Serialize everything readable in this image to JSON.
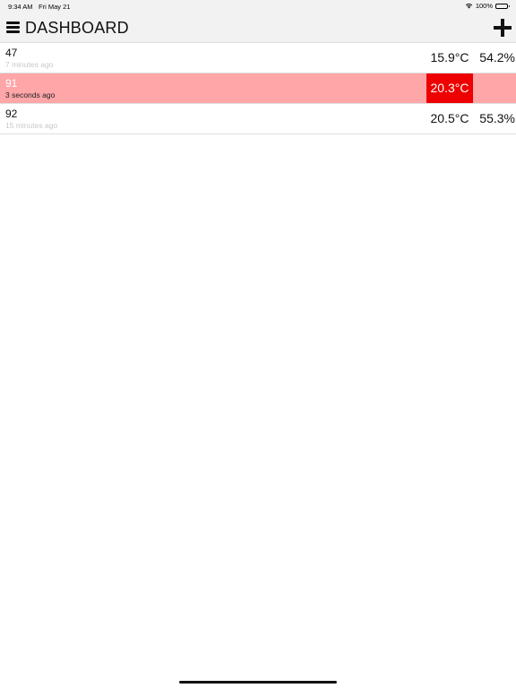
{
  "status_bar": {
    "time": "9:34 AM",
    "date": "Fri May 21",
    "battery": "100%",
    "icons": [
      "wifi-icon",
      "battery-icon"
    ]
  },
  "nav": {
    "title": "DASHBOARD",
    "menu_icon": "hamburger-menu-icon",
    "add_icon": "plus-icon"
  },
  "sensors": [
    {
      "id": "47",
      "updated": "7 minutes ago",
      "temperature": "15.9°C",
      "humidity": "54.2%",
      "alert": false,
      "temp_alarm": false
    },
    {
      "id": "91",
      "updated": "3 seconds ago",
      "temperature": "20.3°C",
      "humidity": "",
      "alert": true,
      "temp_alarm": true
    },
    {
      "id": "92",
      "updated": "15 minutes ago",
      "temperature": "20.5°C",
      "humidity": "55.3%",
      "alert": false,
      "temp_alarm": false
    }
  ],
  "colors": {
    "nav_background": "#f2f2f2",
    "alert_row": "#ffa6a8",
    "alarm_cell": "#ee0000",
    "subtle_text": "#c8c8c8"
  }
}
